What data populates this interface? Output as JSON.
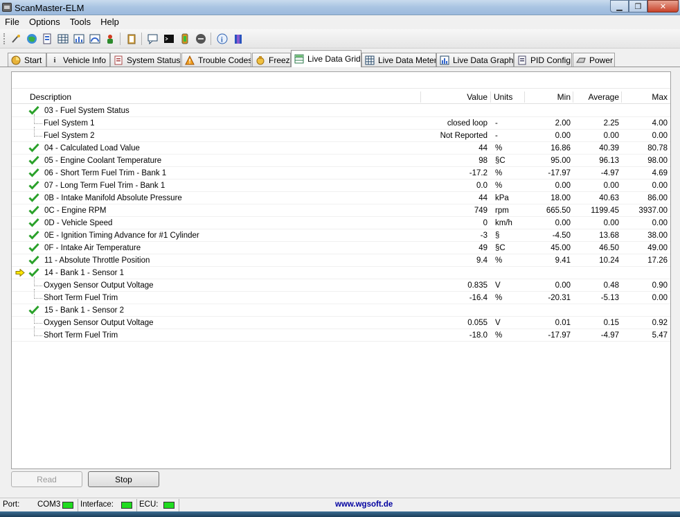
{
  "window": {
    "title": "ScanMaster-ELM"
  },
  "menu": [
    "File",
    "Options",
    "Tools",
    "Help"
  ],
  "toolbar_icons": [
    "connect-icon",
    "globe-icon",
    "vehicle-icon",
    "grid-icon",
    "chart-icon",
    "meter-icon",
    "person-icon",
    "clipboard-icon",
    "comment-icon",
    "terminal-icon",
    "battery-icon",
    "power-icon",
    "info-icon",
    "book-icon"
  ],
  "tabs": [
    {
      "label": "Start",
      "icon": "start-icon",
      "active": false
    },
    {
      "label": "Vehicle Info",
      "icon": "info-icon",
      "active": false
    },
    {
      "label": "System Status",
      "icon": "status-icon",
      "active": false
    },
    {
      "label": "Trouble Codes",
      "icon": "warning-icon",
      "active": false
    },
    {
      "label": "Freez",
      "icon": "freeze-icon",
      "active": false
    },
    {
      "label": "Live Data Grid",
      "icon": "grid-icon",
      "active": true
    },
    {
      "label": "Live Data Meter",
      "icon": "meter-icon",
      "active": false
    },
    {
      "label": "Live Data Graph",
      "icon": "graph-icon",
      "active": false
    },
    {
      "label": "PID Config",
      "icon": "config-icon",
      "active": false
    },
    {
      "label": "Power",
      "icon": "power-icon",
      "active": false
    }
  ],
  "grid": {
    "columns": {
      "description": "Description",
      "value": "Value",
      "units": "Units",
      "min": "Min",
      "average": "Average",
      "max": "Max"
    },
    "rows": [
      {
        "level": 0,
        "check": true,
        "arrow": false,
        "description": "03 - Fuel System Status",
        "value": "",
        "units": "",
        "min": "",
        "average": "",
        "max": ""
      },
      {
        "level": 1,
        "check": false,
        "arrow": false,
        "description": "Fuel System 1",
        "value": "closed loop",
        "units": "-",
        "min": "2.00",
        "average": "2.25",
        "max": "4.00"
      },
      {
        "level": 1,
        "check": false,
        "arrow": false,
        "description": "Fuel System 2",
        "value": "Not Reported",
        "units": "-",
        "min": "0.00",
        "average": "0.00",
        "max": "0.00"
      },
      {
        "level": 0,
        "check": true,
        "arrow": false,
        "description": "04 - Calculated Load Value",
        "value": "44",
        "units": "%",
        "min": "16.86",
        "average": "40.39",
        "max": "80.78"
      },
      {
        "level": 0,
        "check": true,
        "arrow": false,
        "description": "05 - Engine Coolant Temperature",
        "value": "98",
        "units": "§C",
        "min": "95.00",
        "average": "96.13",
        "max": "98.00"
      },
      {
        "level": 0,
        "check": true,
        "arrow": false,
        "description": "06 - Short Term Fuel Trim - Bank 1",
        "value": "-17.2",
        "units": "%",
        "min": "-17.97",
        "average": "-4.97",
        "max": "4.69"
      },
      {
        "level": 0,
        "check": true,
        "arrow": false,
        "description": "07 - Long Term Fuel Trim - Bank 1",
        "value": "0.0",
        "units": "%",
        "min": "0.00",
        "average": "0.00",
        "max": "0.00"
      },
      {
        "level": 0,
        "check": true,
        "arrow": false,
        "description": "0B - Intake Manifold Absolute Pressure",
        "value": "44",
        "units": "kPa",
        "min": "18.00",
        "average": "40.63",
        "max": "86.00"
      },
      {
        "level": 0,
        "check": true,
        "arrow": false,
        "description": "0C - Engine RPM",
        "value": "749",
        "units": "rpm",
        "min": "665.50",
        "average": "1199.45",
        "max": "3937.00"
      },
      {
        "level": 0,
        "check": true,
        "arrow": false,
        "description": "0D - Vehicle Speed",
        "value": "0",
        "units": "km/h",
        "min": "0.00",
        "average": "0.00",
        "max": "0.00"
      },
      {
        "level": 0,
        "check": true,
        "arrow": false,
        "description": "0E - Ignition Timing Advance for #1 Cylinder",
        "value": "-3",
        "units": "§",
        "min": "-4.50",
        "average": "13.68",
        "max": "38.00"
      },
      {
        "level": 0,
        "check": true,
        "arrow": false,
        "description": "0F - Intake Air Temperature",
        "value": "49",
        "units": "§C",
        "min": "45.00",
        "average": "46.50",
        "max": "49.00"
      },
      {
        "level": 0,
        "check": true,
        "arrow": false,
        "description": "11 - Absolute Throttle Position",
        "value": "9.4",
        "units": "%",
        "min": "9.41",
        "average": "10.24",
        "max": "17.26"
      },
      {
        "level": 0,
        "check": true,
        "arrow": true,
        "description": "14 - Bank 1 - Sensor 1",
        "value": "",
        "units": "",
        "min": "",
        "average": "",
        "max": ""
      },
      {
        "level": 1,
        "check": false,
        "arrow": false,
        "description": "Oxygen Sensor Output Voltage",
        "value": "0.835",
        "units": "V",
        "min": "0.00",
        "average": "0.48",
        "max": "0.90"
      },
      {
        "level": 1,
        "check": false,
        "arrow": false,
        "description": "Short Term Fuel Trim",
        "value": "-16.4",
        "units": "%",
        "min": "-20.31",
        "average": "-5.13",
        "max": "0.00"
      },
      {
        "level": 0,
        "check": true,
        "arrow": false,
        "description": "15 - Bank 1 - Sensor 2",
        "value": "",
        "units": "",
        "min": "",
        "average": "",
        "max": ""
      },
      {
        "level": 1,
        "check": false,
        "arrow": false,
        "description": "Oxygen Sensor Output Voltage",
        "value": "0.055",
        "units": "V",
        "min": "0.01",
        "average": "0.15",
        "max": "0.92"
      },
      {
        "level": 1,
        "check": false,
        "arrow": false,
        "description": "Short Term Fuel Trim",
        "value": "-18.0",
        "units": "%",
        "min": "-17.97",
        "average": "-4.97",
        "max": "5.47"
      }
    ]
  },
  "buttons": {
    "read": "Read",
    "stop": "Stop"
  },
  "status": {
    "port_label": "Port:",
    "port_value": "COM3",
    "interface_label": "Interface:",
    "ecu_label": "ECU:",
    "url": "www.wgsoft.de",
    "led_color": "#1fdc1f"
  }
}
